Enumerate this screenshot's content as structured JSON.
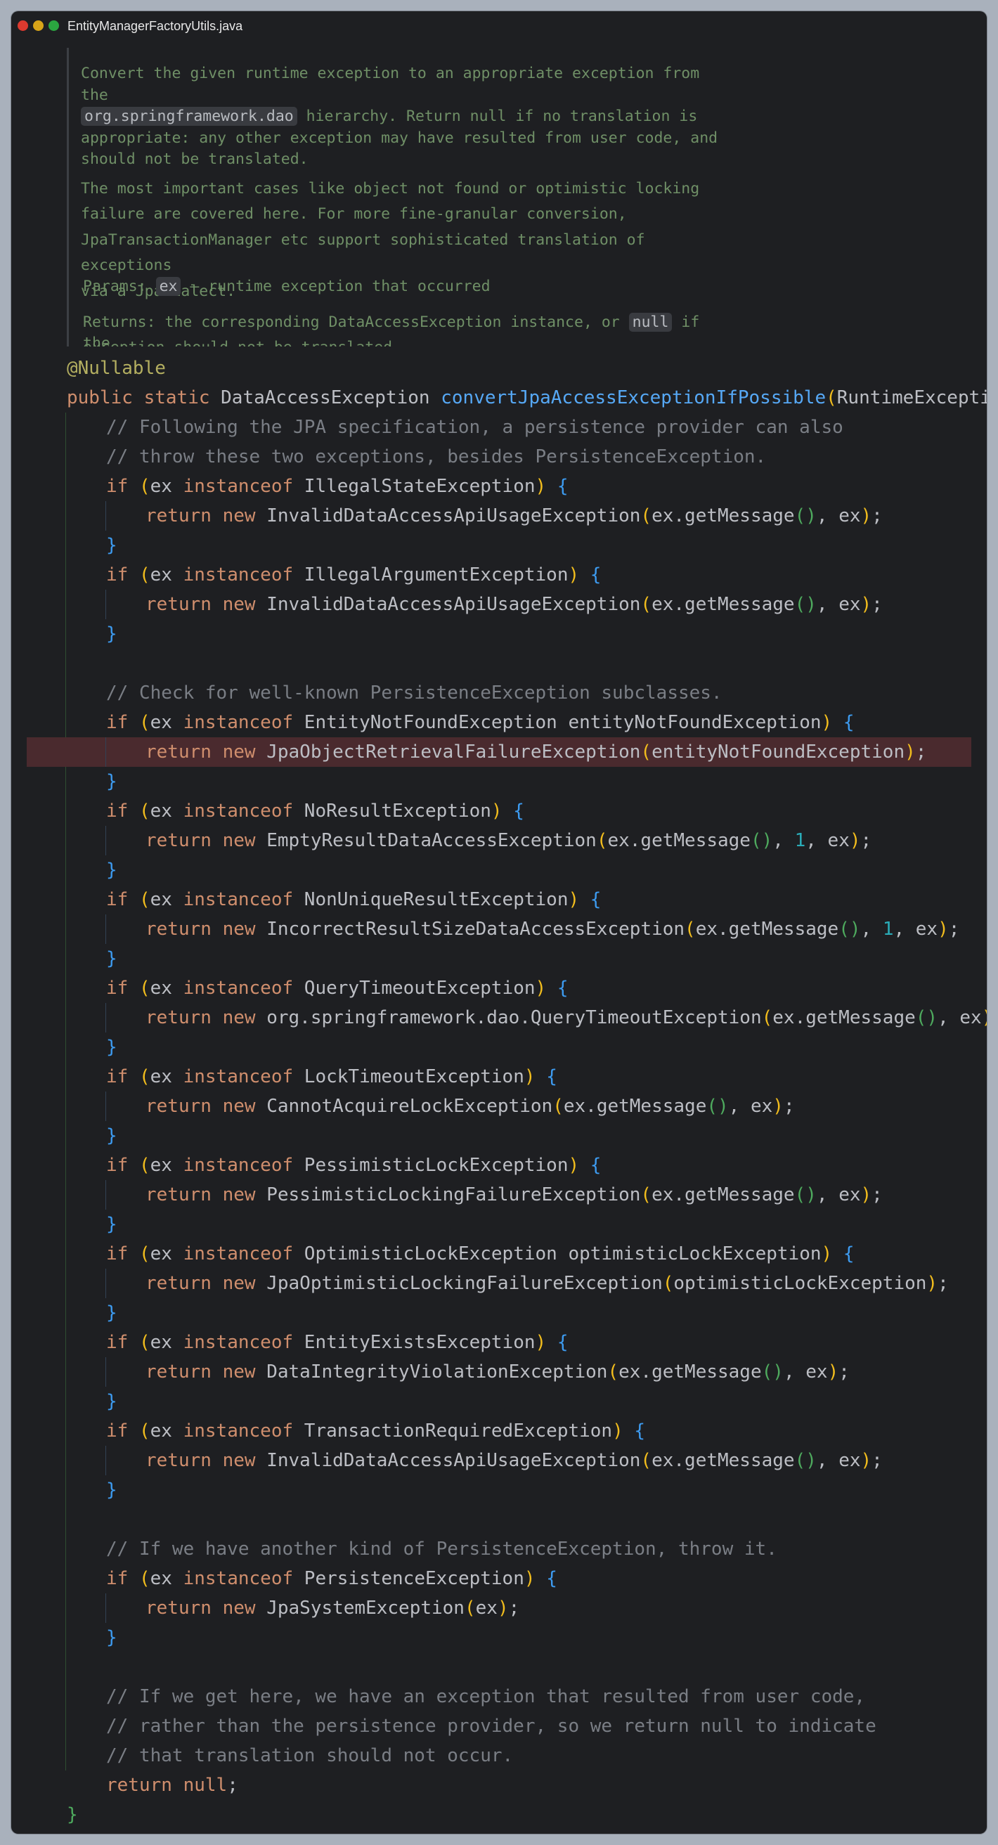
{
  "window": {
    "file_name": "EntityManagerFactoryUtils.java"
  },
  "doc": {
    "p1_a": "Convert the given runtime exception to an appropriate exception from the",
    "p1_code": "org.springframework.dao",
    "p1_b": " hierarchy. Return null if no translation is",
    "p1_c": "appropriate: any other exception may have resulted from user code, and",
    "p1_d": "should not be translated.",
    "p2_a": "The most important cases like object not found or optimistic locking",
    "p2_b": "failure are covered here. For more fine-granular conversion,",
    "p2_c": "JpaTransactionManager etc support sophisticated translation of exceptions",
    "p2_d": "via a JpaDialect.",
    "params_label": "Params:",
    "params_name": "ex",
    "params_desc": " – runtime exception that occurred",
    "returns_label": "Returns:",
    "returns_a": "the corresponding DataAccessException instance, or ",
    "returns_code": "null",
    "returns_b": " if the",
    "returns_c": "       exception should not be translated"
  },
  "code": {
    "annotation": "@Nullable",
    "kw_public": "public",
    "kw_static": "static",
    "return_type": "DataAccessException",
    "method_name": "convertJpaAccessExceptionIfPossible",
    "param_type": "RuntimeException",
    "param_name": "ex",
    "kw_if": "if",
    "kw_instanceof": "instanceof",
    "kw_return": "return",
    "kw_new": "new",
    "kw_null": "null",
    "get_message": "ex.getMessage",
    "one": "1",
    "comment_1": "// Following the JPA specification, a persistence provider can also",
    "comment_2": "// throw these two exceptions, besides PersistenceException.",
    "comment_3": "// Check for well-known PersistenceException subclasses.",
    "comment_4": "// If we have another kind of PersistenceException, throw it.",
    "comment_5": "// If we get here, we have an exception that resulted from user code,",
    "comment_6": "// rather than the persistence provider, so we return null to indicate",
    "comment_7": "// that translation should not occur.",
    "exc_illegal_state": "IllegalStateException",
    "exc_illegal_argument": "IllegalArgumentException",
    "exc_entity_not_found": "EntityNotFoundException",
    "var_entity_not_found": "entityNotFoundException",
    "exc_no_result": "NoResultException",
    "exc_non_unique": "NonUniqueResultException",
    "exc_query_timeout": "QueryTimeoutException",
    "exc_lock_timeout": "LockTimeoutException",
    "exc_pessimistic": "PessimisticLockException",
    "exc_optimistic": "OptimisticLockException",
    "var_optimistic": "optimisticLockException",
    "exc_entity_exists": "EntityExistsException",
    "exc_tx_required": "TransactionRequiredException",
    "exc_persistence": "PersistenceException",
    "new_invalid_api": "InvalidDataAccessApiUsageException",
    "new_jpa_object_retrieval": "JpaObjectRetrievalFailureException",
    "new_empty_result": "EmptyResultDataAccessException",
    "new_incorrect_size": "IncorrectResultSizeDataAccessException",
    "new_query_timeout": "org.springframework.dao.QueryTimeoutException",
    "new_cannot_acquire": "CannotAcquireLockException",
    "new_pessimistic_failure": "PessimisticLockingFailureException",
    "new_jpa_optimistic": "JpaOptimisticLockingFailureException",
    "new_data_integrity": "DataIntegrityViolationException",
    "new_jpa_system": "JpaSystemException"
  }
}
